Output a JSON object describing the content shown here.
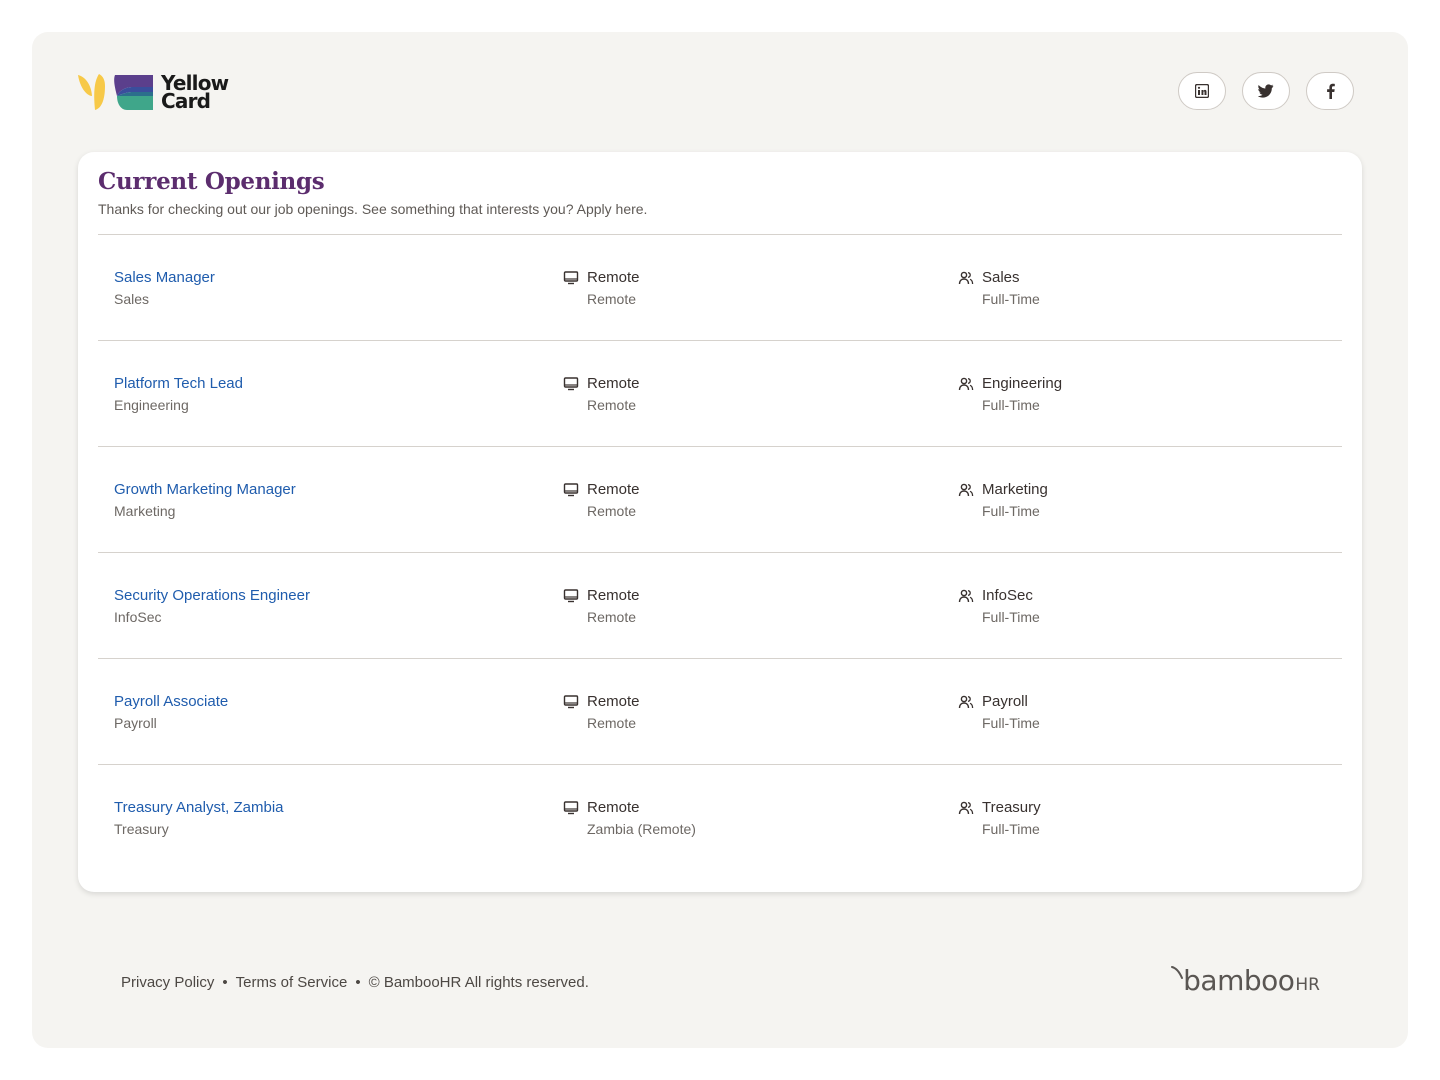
{
  "brand": {
    "name_line1": "Yellow",
    "name_line2": "Card",
    "colors": {
      "yellow": "#f7c948",
      "purple": "#5b3f8c",
      "green": "#3fa68a"
    }
  },
  "social": [
    {
      "name": "linkedin",
      "icon": "linkedin-icon"
    },
    {
      "name": "twitter",
      "icon": "twitter-icon"
    },
    {
      "name": "facebook",
      "icon": "facebook-icon"
    }
  ],
  "openings": {
    "title": "Current Openings",
    "subtitle": "Thanks for checking out our job openings. See something that interests you? Apply here."
  },
  "jobs": [
    {
      "title": "Sales Manager",
      "department": "Sales",
      "location_type": "Remote",
      "location": "Remote",
      "team": "Sales",
      "employment": "Full-Time"
    },
    {
      "title": "Platform Tech Lead",
      "department": "Engineering",
      "location_type": "Remote",
      "location": "Remote",
      "team": "Engineering",
      "employment": "Full-Time"
    },
    {
      "title": "Growth Marketing Manager",
      "department": "Marketing",
      "location_type": "Remote",
      "location": "Remote",
      "team": "Marketing",
      "employment": "Full-Time"
    },
    {
      "title": "Security Operations Engineer",
      "department": "InfoSec",
      "location_type": "Remote",
      "location": "Remote",
      "team": "InfoSec",
      "employment": "Full-Time"
    },
    {
      "title": "Payroll Associate",
      "department": "Payroll",
      "location_type": "Remote",
      "location": "Remote",
      "team": "Payroll",
      "employment": "Full-Time"
    },
    {
      "title": "Treasury Analyst, Zambia",
      "department": "Treasury",
      "location_type": "Remote",
      "location": "Zambia (Remote)",
      "team": "Treasury",
      "employment": "Full-Time"
    }
  ],
  "footer": {
    "privacy": "Privacy Policy",
    "separator": "•",
    "terms": "Terms of Service",
    "copyright": "© BambooHR All rights reserved.",
    "powered_by_word": "bamboo",
    "powered_by_suffix": "HR"
  },
  "colors": {
    "link": "#1f5cad",
    "title": "#5c2d6e",
    "page_bg": "#f5f4f1"
  }
}
